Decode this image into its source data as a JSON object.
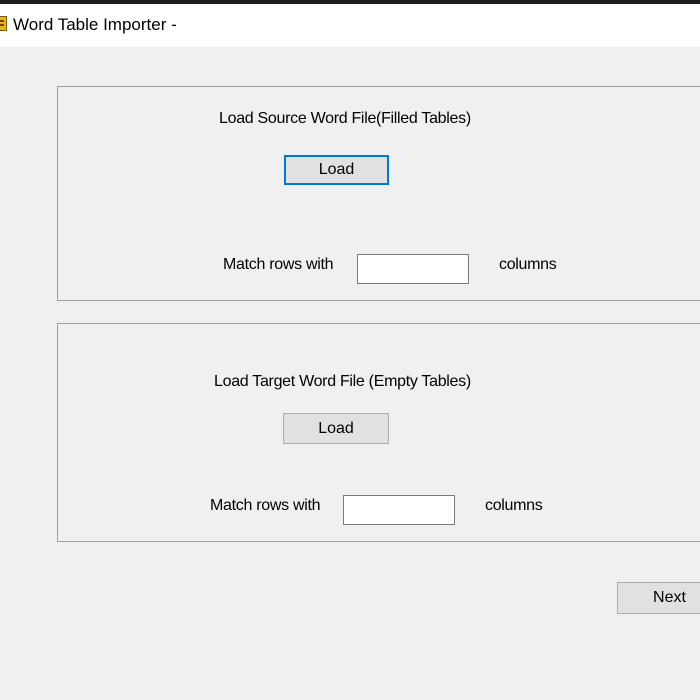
{
  "window": {
    "title": "Word Table Importer -"
  },
  "source_group": {
    "heading": "Load Source Word File(Filled Tables)",
    "load_label": "Load",
    "match_prefix": "Match rows with",
    "columns_value": "",
    "match_suffix": "columns"
  },
  "target_group": {
    "heading": "Load Target Word File (Empty Tables)",
    "load_label": "Load",
    "match_prefix": "Match rows with",
    "columns_value": "",
    "match_suffix": "columns"
  },
  "footer": {
    "next_label": "Next"
  },
  "colors": {
    "window_bg": "#f0f0f0",
    "titlebar_bg": "#ffffff",
    "focus_border": "#0078d7",
    "button_bg": "#e1e1e1"
  },
  "icons": {
    "app_icon": "app-icon"
  }
}
